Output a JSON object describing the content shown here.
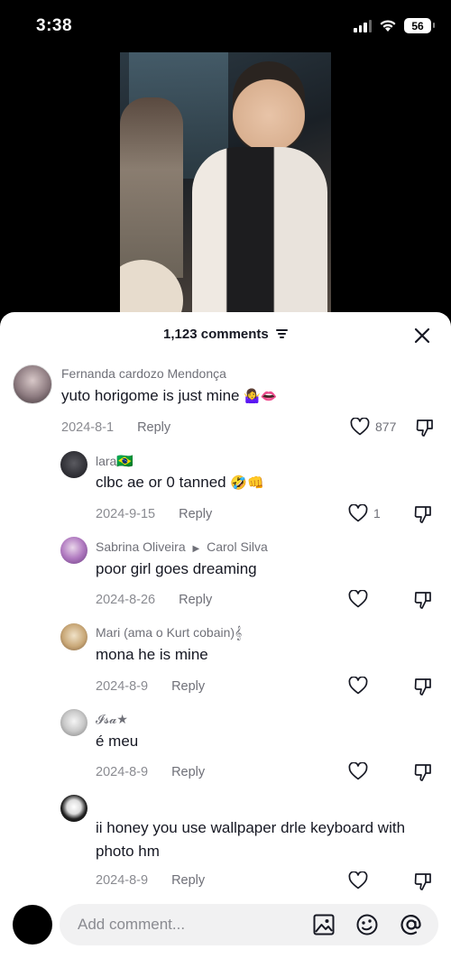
{
  "status_bar": {
    "time": "3:38",
    "battery": "56"
  },
  "sheet": {
    "comment_count": "1,123 comments"
  },
  "comments": [
    {
      "name": "Fernanda cardozo Mendonça",
      "text": "yuto horigome is just mine",
      "emoji": "🤷‍♀️👄",
      "date": "2024-8-1",
      "reply": "Reply",
      "likes": "877"
    },
    {
      "name": "lara",
      "name_suffix": "🇧🇷",
      "text": "clbc ae or 0 tanned",
      "emoji": "🤣👊",
      "date": "2024-9-15",
      "reply": "Reply",
      "likes": "1"
    },
    {
      "name": "Sabrina Oliveira",
      "reply_to": "Carol Silva",
      "text": "poor girl goes dreaming",
      "date": "2024-8-26",
      "reply": "Reply",
      "likes": ""
    },
    {
      "name": "Mari (ama o Kurt cobain)𝄞",
      "text": "mona he is mine",
      "date": "2024-8-9",
      "reply": "Reply",
      "likes": ""
    },
    {
      "name": "𝓘𝓼𝓪★",
      "text": "é meu",
      "date": "2024-8-9",
      "reply": "Reply",
      "likes": ""
    },
    {
      "name": "",
      "text": "ii honey you use wallpaper drle keyboard with photo hm",
      "date": "2024-8-9",
      "reply": "Reply",
      "likes": ""
    }
  ],
  "input": {
    "placeholder": "Add comment..."
  },
  "icons": {
    "filter": "filter-icon",
    "close": "close-icon",
    "like": "heart-icon",
    "dislike": "thumbs-down-icon",
    "image": "image-icon",
    "emoji": "emoji-icon",
    "mention": "at-icon"
  }
}
